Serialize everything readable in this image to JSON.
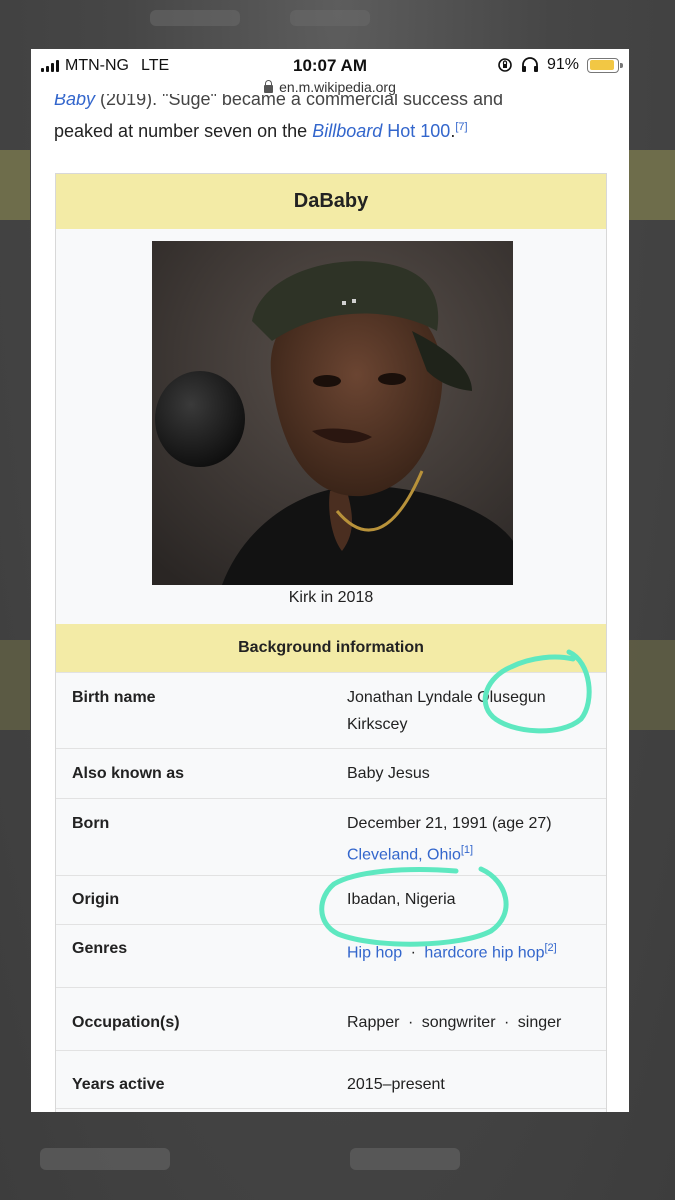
{
  "status_bar": {
    "carrier": "MTN-NG",
    "network": "LTE",
    "time": "10:07 AM",
    "battery_percent": "91%",
    "battery_level": 0.91,
    "url": "en.m.wikipedia.org"
  },
  "article": {
    "cut_line_pre": "Baby",
    "cut_line_post": "(2019). \"Suge\" became a commercial success and",
    "line_before": "peaked at number seven on the",
    "billboard": "Billboard",
    "hot100": "Hot 100",
    "ref7": "[7]"
  },
  "infobox": {
    "title": "DaBaby",
    "caption": "Kirk in 2018",
    "section_header": "Background information",
    "rows": {
      "birth_name": {
        "label": "Birth name",
        "line1": "Jonathan Lyndale Olusegun",
        "line2": "Kirkscey"
      },
      "aka": {
        "label": "Also known as",
        "value": "Baby Jesus"
      },
      "born": {
        "label": "Born",
        "date": "December 21, 1991 (age 27)",
        "place": "Cleveland, Ohio",
        "ref": "[1]"
      },
      "origin": {
        "label": "Origin",
        "value": "Ibadan, Nigeria"
      },
      "genres": {
        "label": "Genres",
        "g1": "Hip hop",
        "sep": "·",
        "g2": "hardcore hip hop",
        "ref": "[2]"
      },
      "occupation": {
        "label": "Occupation(s)",
        "o1": "Rapper",
        "o2": "songwriter",
        "o3": "singer",
        "sep": "·"
      },
      "years_active": {
        "label": "Years active",
        "value": "2015–present"
      }
    }
  },
  "colors": {
    "infobox_header": "#f3eba6",
    "link": "#3366cc",
    "annotation": "#5ee8c0"
  }
}
